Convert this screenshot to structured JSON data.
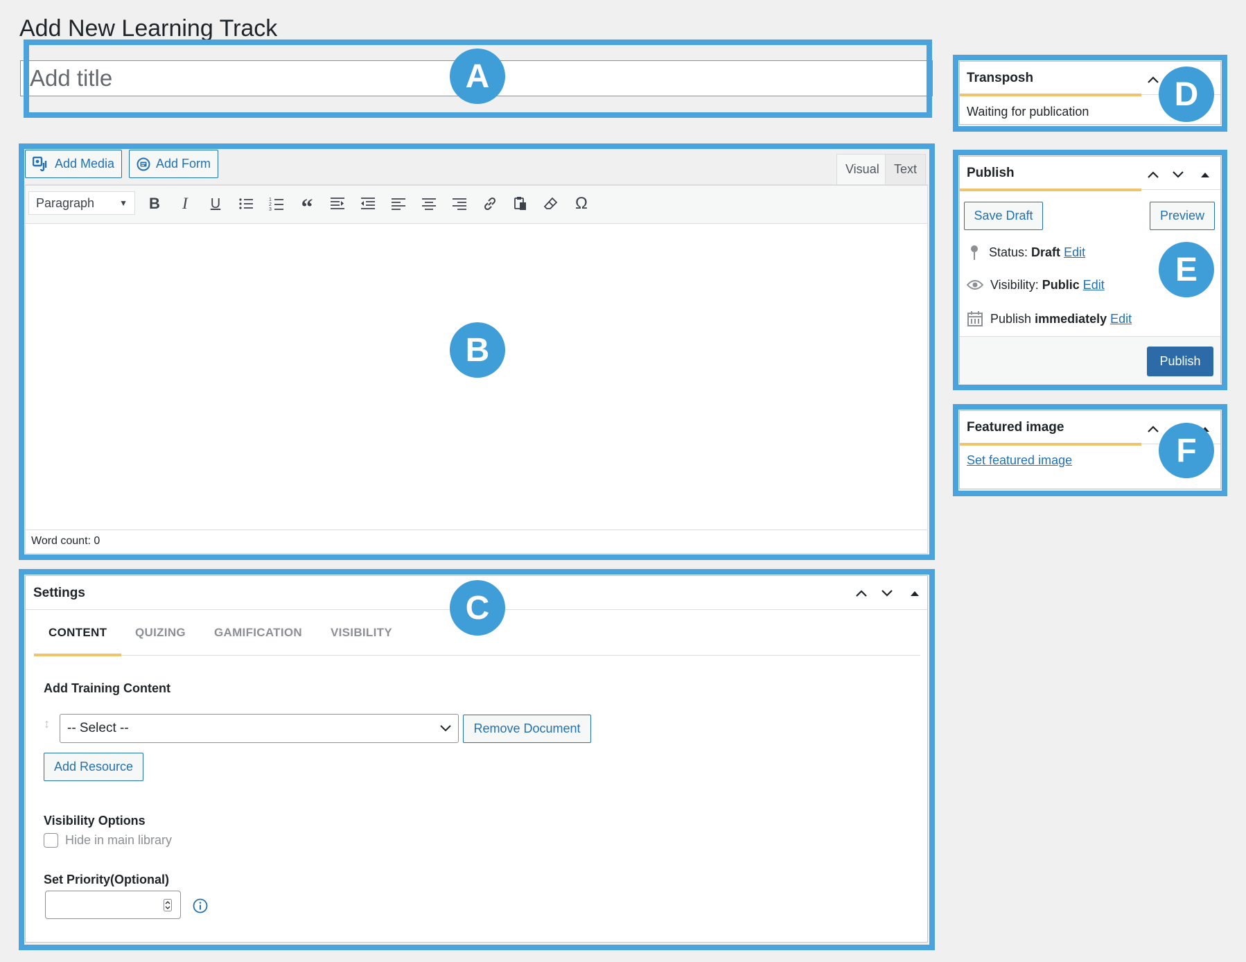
{
  "page": {
    "title": "Add New Learning Track"
  },
  "title_field": {
    "placeholder": "Add title"
  },
  "editor": {
    "add_media": "Add Media",
    "add_form": "Add Form",
    "tabs": {
      "visual": "Visual",
      "text": "Text"
    },
    "format_select": "Paragraph",
    "omega": "Ω",
    "word_count": "Word count: 0"
  },
  "settings": {
    "title": "Settings",
    "tabs": [
      "CONTENT",
      "QUIZING",
      "GAMIFICATION",
      "VISIBILITY"
    ],
    "active_tab": "CONTENT",
    "add_training_label": "Add Training Content",
    "select_value": "-- Select --",
    "remove_document": "Remove Document",
    "add_resource": "Add Resource",
    "visibility_options_label": "Visibility Options",
    "hide_checkbox_label": "Hide in main library",
    "priority_label": "Set Priority(Optional)"
  },
  "sidebar": {
    "transposh": {
      "title": "Transposh",
      "status": "Waiting for publication"
    },
    "publish": {
      "title": "Publish",
      "save_draft": "Save Draft",
      "preview": "Preview",
      "status_label": "Status:",
      "status_value": "Draft",
      "visibility_label": "Visibility:",
      "visibility_value": "Public",
      "publish_label": "Publish",
      "publish_value": "immediately",
      "edit": "Edit",
      "publish_button": "Publish"
    },
    "featured_image": {
      "title": "Featured image",
      "link": "Set featured image"
    }
  },
  "badges": {
    "a": "A",
    "b": "B",
    "c": "C",
    "d": "D",
    "e": "E",
    "f": "F"
  },
  "colors": {
    "highlight": "#4aa3dc",
    "badge": "#3f9ed8",
    "primary": "#2271b1",
    "tab_accent": "#f0c36d"
  }
}
